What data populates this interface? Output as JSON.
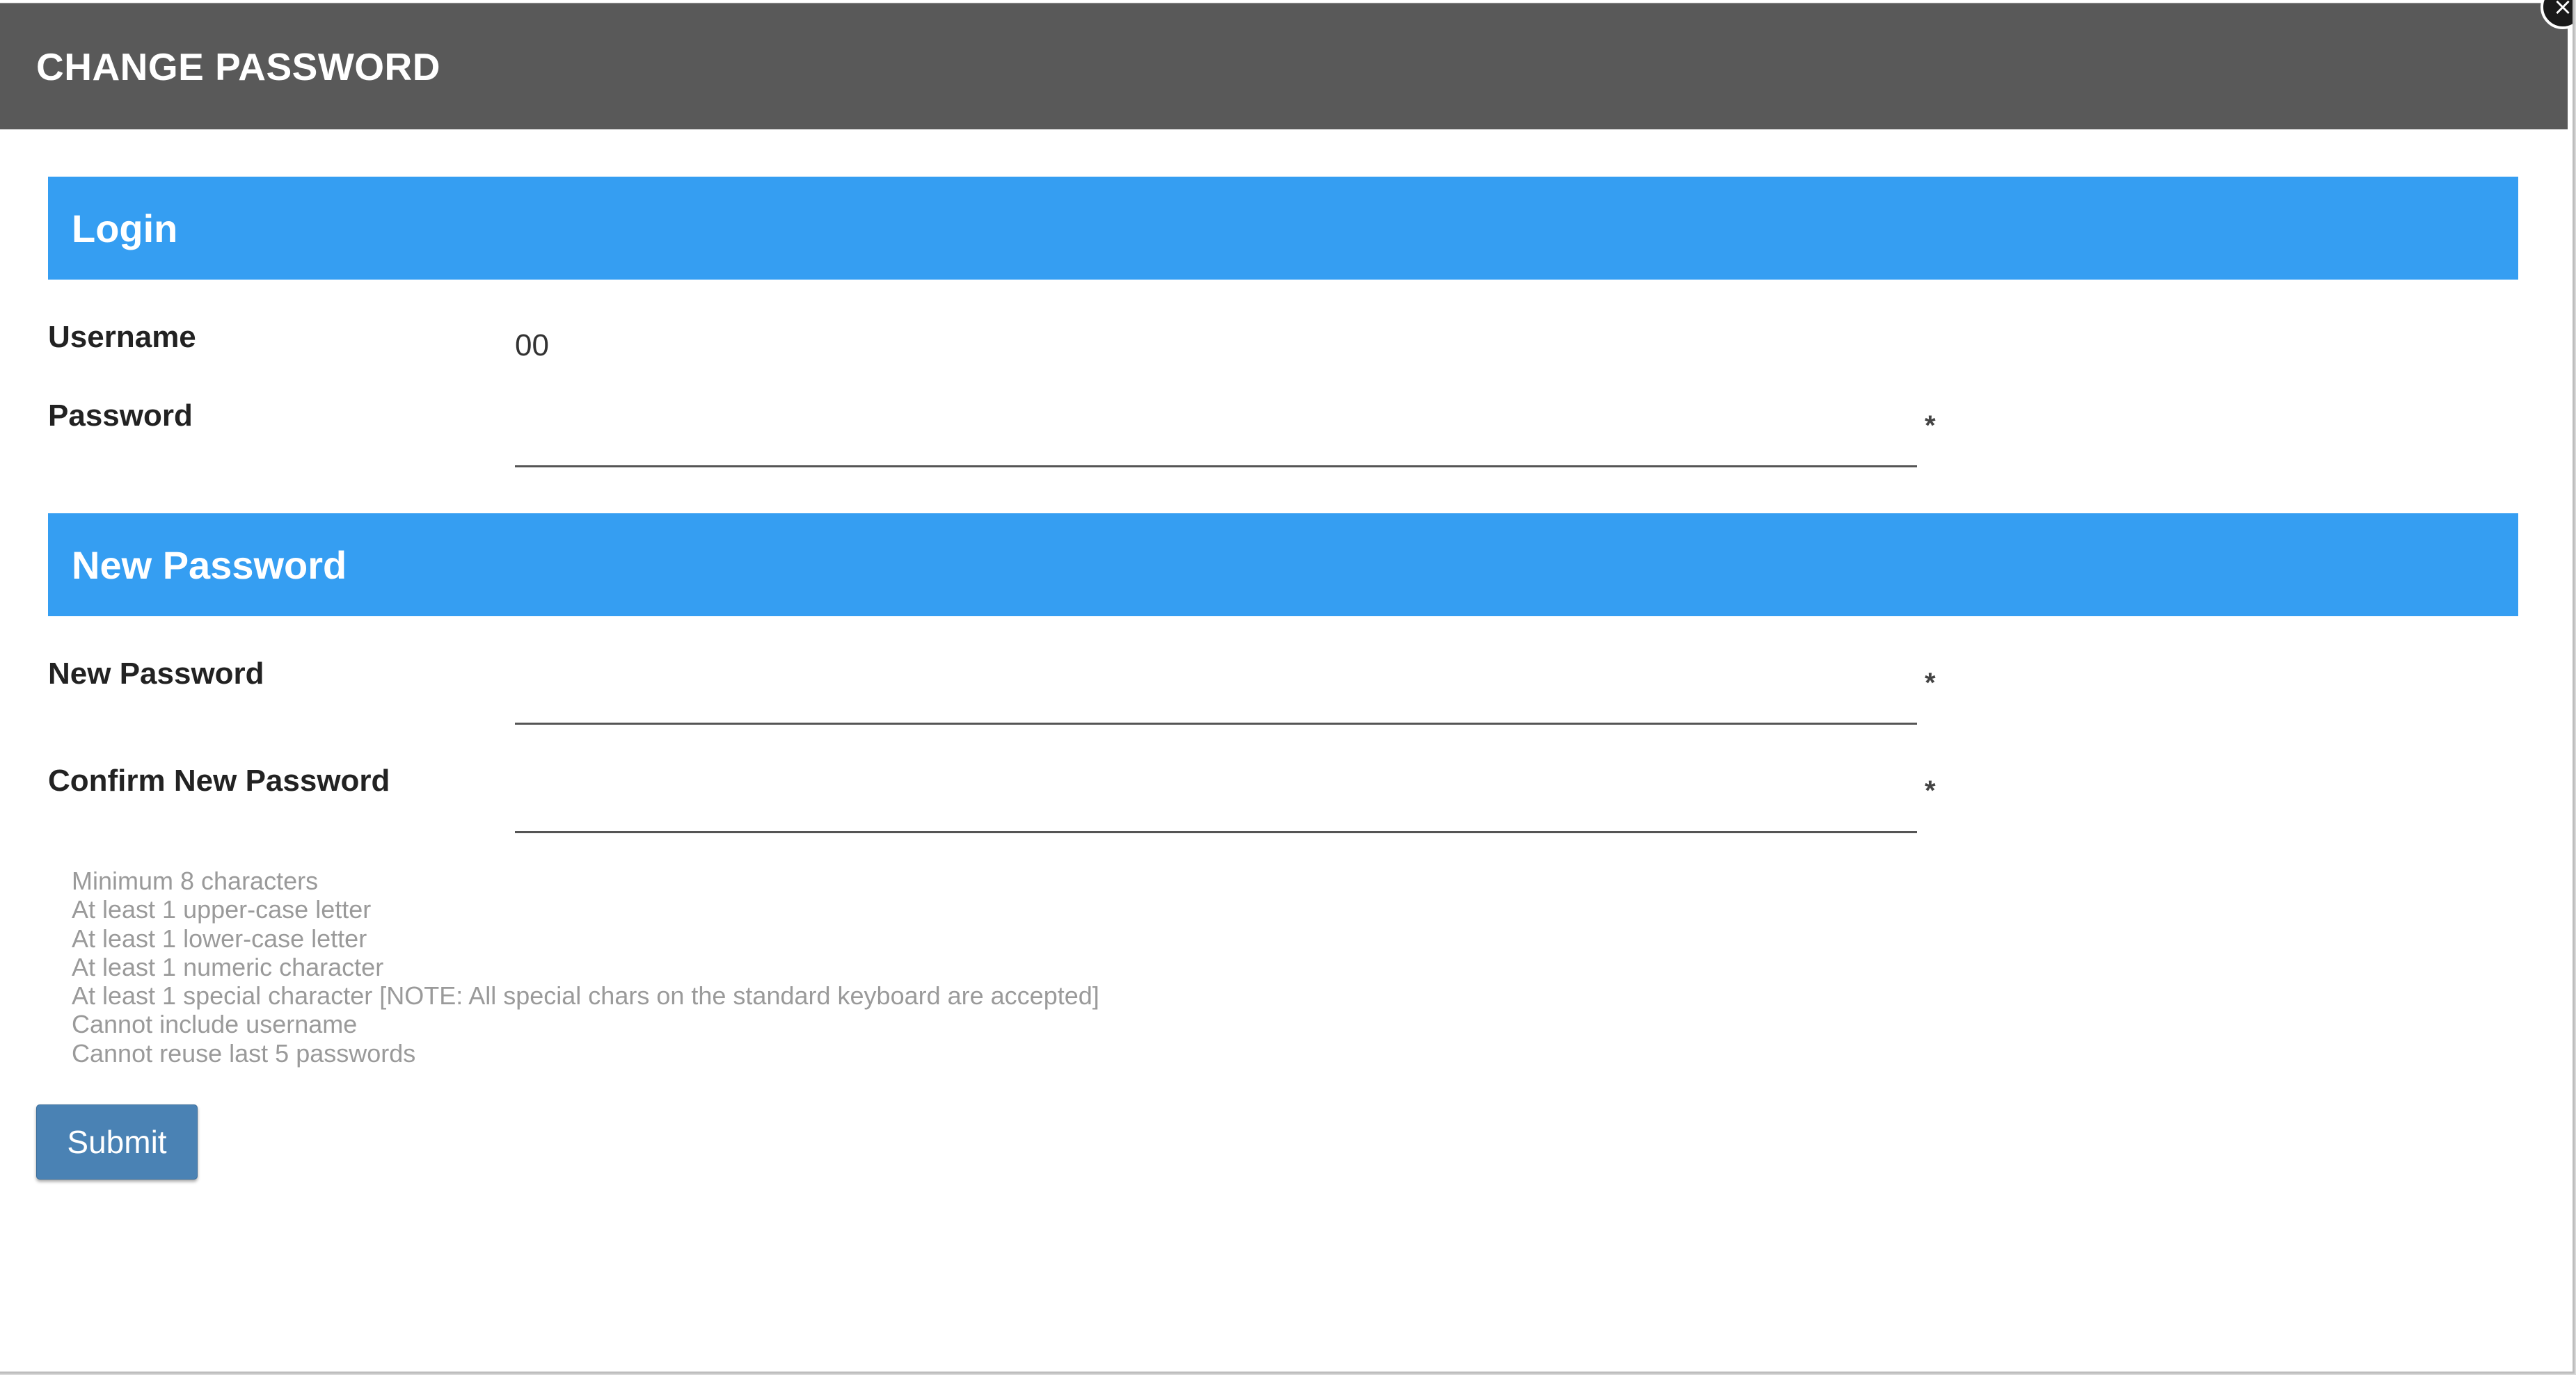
{
  "dialog": {
    "title": "CHANGE PASSWORD",
    "close_glyph": "×"
  },
  "login_section": {
    "header": "Login",
    "username_label": "Username",
    "username_value": "00",
    "password_label": "Password",
    "password_value": "",
    "password_required": "*"
  },
  "new_password_section": {
    "header": "New Password",
    "new_password_label": "New Password",
    "new_password_value": "",
    "new_password_required": "*",
    "confirm_label": "Confirm New Password",
    "confirm_value": "",
    "confirm_required": "*"
  },
  "password_rules": [
    "Minimum 8 characters",
    "At least 1 upper-case letter",
    "At least 1 lower-case letter",
    "At least 1 numeric character",
    "At least 1 special character [NOTE: All special chars on the standard keyboard are accepted]",
    "Cannot include username",
    "Cannot reuse last 5 passwords"
  ],
  "actions": {
    "submit_label": "Submit"
  },
  "colors": {
    "titlebar": "#595959",
    "section_header": "#359ef2",
    "submit_button": "#4a82b4",
    "rule_text": "#9a9a9a"
  },
  "icons": {
    "close": "close-icon"
  }
}
